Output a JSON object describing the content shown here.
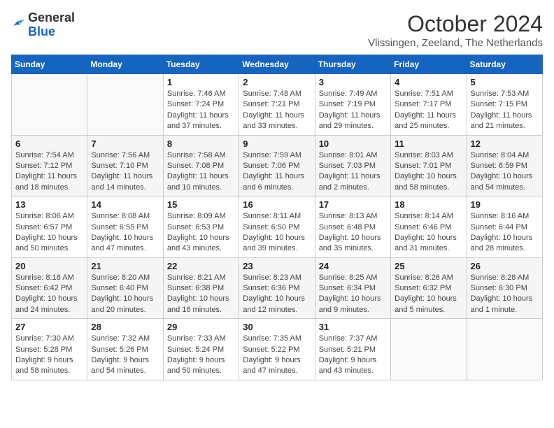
{
  "header": {
    "logo_general": "General",
    "logo_blue": "Blue",
    "month_title": "October 2024",
    "location": "Vlissingen, Zeeland, The Netherlands"
  },
  "days_of_week": [
    "Sunday",
    "Monday",
    "Tuesday",
    "Wednesday",
    "Thursday",
    "Friday",
    "Saturday"
  ],
  "weeks": [
    [
      {
        "day": "",
        "sunrise": "",
        "sunset": "",
        "daylight": ""
      },
      {
        "day": "",
        "sunrise": "",
        "sunset": "",
        "daylight": ""
      },
      {
        "day": "1",
        "sunrise": "Sunrise: 7:46 AM",
        "sunset": "Sunset: 7:24 PM",
        "daylight": "Daylight: 11 hours and 37 minutes."
      },
      {
        "day": "2",
        "sunrise": "Sunrise: 7:48 AM",
        "sunset": "Sunset: 7:21 PM",
        "daylight": "Daylight: 11 hours and 33 minutes."
      },
      {
        "day": "3",
        "sunrise": "Sunrise: 7:49 AM",
        "sunset": "Sunset: 7:19 PM",
        "daylight": "Daylight: 11 hours and 29 minutes."
      },
      {
        "day": "4",
        "sunrise": "Sunrise: 7:51 AM",
        "sunset": "Sunset: 7:17 PM",
        "daylight": "Daylight: 11 hours and 25 minutes."
      },
      {
        "day": "5",
        "sunrise": "Sunrise: 7:53 AM",
        "sunset": "Sunset: 7:15 PM",
        "daylight": "Daylight: 11 hours and 21 minutes."
      }
    ],
    [
      {
        "day": "6",
        "sunrise": "Sunrise: 7:54 AM",
        "sunset": "Sunset: 7:12 PM",
        "daylight": "Daylight: 11 hours and 18 minutes."
      },
      {
        "day": "7",
        "sunrise": "Sunrise: 7:56 AM",
        "sunset": "Sunset: 7:10 PM",
        "daylight": "Daylight: 11 hours and 14 minutes."
      },
      {
        "day": "8",
        "sunrise": "Sunrise: 7:58 AM",
        "sunset": "Sunset: 7:08 PM",
        "daylight": "Daylight: 11 hours and 10 minutes."
      },
      {
        "day": "9",
        "sunrise": "Sunrise: 7:59 AM",
        "sunset": "Sunset: 7:06 PM",
        "daylight": "Daylight: 11 hours and 6 minutes."
      },
      {
        "day": "10",
        "sunrise": "Sunrise: 8:01 AM",
        "sunset": "Sunset: 7:03 PM",
        "daylight": "Daylight: 11 hours and 2 minutes."
      },
      {
        "day": "11",
        "sunrise": "Sunrise: 8:03 AM",
        "sunset": "Sunset: 7:01 PM",
        "daylight": "Daylight: 10 hours and 58 minutes."
      },
      {
        "day": "12",
        "sunrise": "Sunrise: 8:04 AM",
        "sunset": "Sunset: 6:59 PM",
        "daylight": "Daylight: 10 hours and 54 minutes."
      }
    ],
    [
      {
        "day": "13",
        "sunrise": "Sunrise: 8:06 AM",
        "sunset": "Sunset: 6:57 PM",
        "daylight": "Daylight: 10 hours and 50 minutes."
      },
      {
        "day": "14",
        "sunrise": "Sunrise: 8:08 AM",
        "sunset": "Sunset: 6:55 PM",
        "daylight": "Daylight: 10 hours and 47 minutes."
      },
      {
        "day": "15",
        "sunrise": "Sunrise: 8:09 AM",
        "sunset": "Sunset: 6:53 PM",
        "daylight": "Daylight: 10 hours and 43 minutes."
      },
      {
        "day": "16",
        "sunrise": "Sunrise: 8:11 AM",
        "sunset": "Sunset: 6:50 PM",
        "daylight": "Daylight: 10 hours and 39 minutes."
      },
      {
        "day": "17",
        "sunrise": "Sunrise: 8:13 AM",
        "sunset": "Sunset: 6:48 PM",
        "daylight": "Daylight: 10 hours and 35 minutes."
      },
      {
        "day": "18",
        "sunrise": "Sunrise: 8:14 AM",
        "sunset": "Sunset: 6:46 PM",
        "daylight": "Daylight: 10 hours and 31 minutes."
      },
      {
        "day": "19",
        "sunrise": "Sunrise: 8:16 AM",
        "sunset": "Sunset: 6:44 PM",
        "daylight": "Daylight: 10 hours and 28 minutes."
      }
    ],
    [
      {
        "day": "20",
        "sunrise": "Sunrise: 8:18 AM",
        "sunset": "Sunset: 6:42 PM",
        "daylight": "Daylight: 10 hours and 24 minutes."
      },
      {
        "day": "21",
        "sunrise": "Sunrise: 8:20 AM",
        "sunset": "Sunset: 6:40 PM",
        "daylight": "Daylight: 10 hours and 20 minutes."
      },
      {
        "day": "22",
        "sunrise": "Sunrise: 8:21 AM",
        "sunset": "Sunset: 6:38 PM",
        "daylight": "Daylight: 10 hours and 16 minutes."
      },
      {
        "day": "23",
        "sunrise": "Sunrise: 8:23 AM",
        "sunset": "Sunset: 6:36 PM",
        "daylight": "Daylight: 10 hours and 12 minutes."
      },
      {
        "day": "24",
        "sunrise": "Sunrise: 8:25 AM",
        "sunset": "Sunset: 6:34 PM",
        "daylight": "Daylight: 10 hours and 9 minutes."
      },
      {
        "day": "25",
        "sunrise": "Sunrise: 8:26 AM",
        "sunset": "Sunset: 6:32 PM",
        "daylight": "Daylight: 10 hours and 5 minutes."
      },
      {
        "day": "26",
        "sunrise": "Sunrise: 8:28 AM",
        "sunset": "Sunset: 6:30 PM",
        "daylight": "Daylight: 10 hours and 1 minute."
      }
    ],
    [
      {
        "day": "27",
        "sunrise": "Sunrise: 7:30 AM",
        "sunset": "Sunset: 5:28 PM",
        "daylight": "Daylight: 9 hours and 58 minutes."
      },
      {
        "day": "28",
        "sunrise": "Sunrise: 7:32 AM",
        "sunset": "Sunset: 5:26 PM",
        "daylight": "Daylight: 9 hours and 54 minutes."
      },
      {
        "day": "29",
        "sunrise": "Sunrise: 7:33 AM",
        "sunset": "Sunset: 5:24 PM",
        "daylight": "Daylight: 9 hours and 50 minutes."
      },
      {
        "day": "30",
        "sunrise": "Sunrise: 7:35 AM",
        "sunset": "Sunset: 5:22 PM",
        "daylight": "Daylight: 9 hours and 47 minutes."
      },
      {
        "day": "31",
        "sunrise": "Sunrise: 7:37 AM",
        "sunset": "Sunset: 5:21 PM",
        "daylight": "Daylight: 9 hours and 43 minutes."
      },
      {
        "day": "",
        "sunrise": "",
        "sunset": "",
        "daylight": ""
      },
      {
        "day": "",
        "sunrise": "",
        "sunset": "",
        "daylight": ""
      }
    ]
  ]
}
